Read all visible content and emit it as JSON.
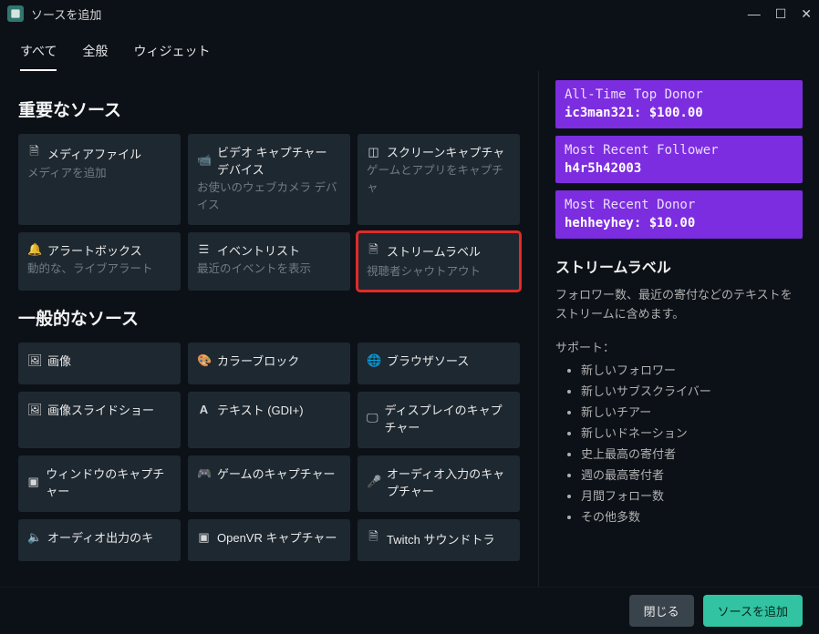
{
  "window": {
    "title": "ソースを追加"
  },
  "tabs": {
    "all": "すべて",
    "general": "全般",
    "widgets": "ウィジェット"
  },
  "sections": {
    "important": "重要なソース",
    "general": "一般的なソース"
  },
  "important_cards": [
    {
      "icon": "file",
      "title": "メディアファイル",
      "desc": "メディアを追加"
    },
    {
      "icon": "video",
      "title": "ビデオ キャプチャー デバイス",
      "desc": "お使いのウェブカメラ デバイス"
    },
    {
      "icon": "dashed-square",
      "title": "スクリーンキャプチャ",
      "desc": "ゲームとアプリをキャプチャ"
    },
    {
      "icon": "bell",
      "title": "アラートボックス",
      "desc": "動的な、ライブアラート"
    },
    {
      "icon": "list",
      "title": "イベントリスト",
      "desc": "最近のイベントを表示"
    },
    {
      "icon": "page",
      "title": "ストリームラベル",
      "desc": "視聴者シャウトアウト"
    }
  ],
  "general_cards": [
    {
      "icon": "image",
      "title": "画像",
      "desc": ""
    },
    {
      "icon": "palette",
      "title": "カラーブロック",
      "desc": ""
    },
    {
      "icon": "globe",
      "title": "ブラウザソース",
      "desc": ""
    },
    {
      "icon": "image",
      "title": "画像スライドショー",
      "desc": ""
    },
    {
      "icon": "text",
      "title": "テキスト (GDI+)",
      "desc": ""
    },
    {
      "icon": "monitor",
      "title": "ディスプレイのキャプチャー",
      "desc": ""
    },
    {
      "icon": "window",
      "title": "ウィンドウのキャプチャー",
      "desc": ""
    },
    {
      "icon": "gamepad",
      "title": "ゲームのキャプチャー",
      "desc": ""
    },
    {
      "icon": "mic",
      "title": "オーディオ入力のキャプチャー",
      "desc": ""
    },
    {
      "icon": "speaker",
      "title": "オーディオ出力のキ",
      "desc": ""
    },
    {
      "icon": "vr",
      "title": "OpenVR キャプチャー",
      "desc": ""
    },
    {
      "icon": "page",
      "title": "Twitch サウンドトラ",
      "desc": ""
    }
  ],
  "preview": {
    "donor_top_label": "All-Time Top Donor",
    "donor_top_value": "ic3man321: $100.00",
    "follower_label": "Most Recent Follower",
    "follower_value": "h4r5h42003",
    "donor_recent_label": "Most Recent Donor",
    "donor_recent_value": "hehheyhey: $10.00"
  },
  "detail": {
    "title": "ストリームラベル",
    "desc": "フォロワー数、最近の寄付などのテキストをストリームに含めます。",
    "support_label": "サポート：",
    "supports": [
      "新しいフォロワー",
      "新しいサブスクライバー",
      "新しいチアー",
      "新しいドネーション",
      "史上最高の寄付者",
      "週の最高寄付者",
      "月間フォロー数",
      "その他多数"
    ]
  },
  "footer": {
    "close": "閉じる",
    "add": "ソースを追加"
  }
}
